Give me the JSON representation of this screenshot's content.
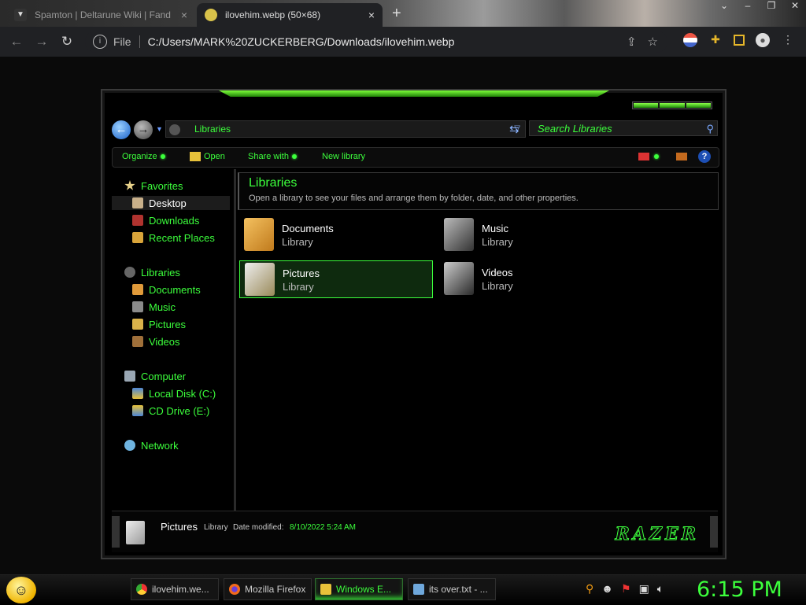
{
  "browser": {
    "tabs": [
      {
        "title": "Spamton | Deltarune Wiki | Fand",
        "close": "×"
      },
      {
        "title": "ilovehim.webp (50×68)",
        "close": "×"
      }
    ],
    "new_tab": "+",
    "address": {
      "scheme_label": "File",
      "url": "C:/Users/MARK%20ZUCKERBERG/Downloads/ilovehim.webp"
    },
    "nav": {
      "back": "←",
      "forward": "→",
      "reload": "↻"
    }
  },
  "explorer": {
    "breadcrumb": "Libraries",
    "search_placeholder": "Search Libraries",
    "toolbar": {
      "organize": "Organize",
      "open": "Open",
      "share_with": "Share with",
      "new_library": "New library",
      "help": "?"
    },
    "nav_pane": {
      "favorites": "Favorites",
      "desktop": "Desktop",
      "downloads": "Downloads",
      "recent_places": "Recent Places",
      "libraries": "Libraries",
      "documents": "Documents",
      "music": "Music",
      "pictures": "Pictures",
      "videos": "Videos",
      "computer": "Computer",
      "local_disk": "Local Disk (C:)",
      "cd_drive": "CD Drive (E:)",
      "network": "Network"
    },
    "header": {
      "title": "Libraries",
      "description": "Open a library to see your files and arrange them by folder, date, and other properties."
    },
    "libraries": [
      {
        "name": "Documents",
        "type": "Library"
      },
      {
        "name": "Music",
        "type": "Library"
      },
      {
        "name": "Pictures",
        "type": "Library"
      },
      {
        "name": "Videos",
        "type": "Library"
      }
    ],
    "status": {
      "name": "Pictures",
      "type": "Library",
      "date_label": "Date modified:",
      "date_value": "8/10/2022 5:24 AM",
      "brand": "RAZER"
    }
  },
  "taskbar": {
    "items": [
      {
        "label": "ilovehim.we...",
        "icon": "chrome-icon"
      },
      {
        "label": "Mozilla Firefox",
        "icon": "firefox-icon"
      },
      {
        "label": "Windows E...",
        "icon": "folder-icon"
      },
      {
        "label": "its over.txt - ...",
        "icon": "notepad-icon"
      }
    ],
    "clock": "6:15 PM"
  },
  "colors": {
    "accent": "#3cff3c",
    "background": "#000000"
  }
}
